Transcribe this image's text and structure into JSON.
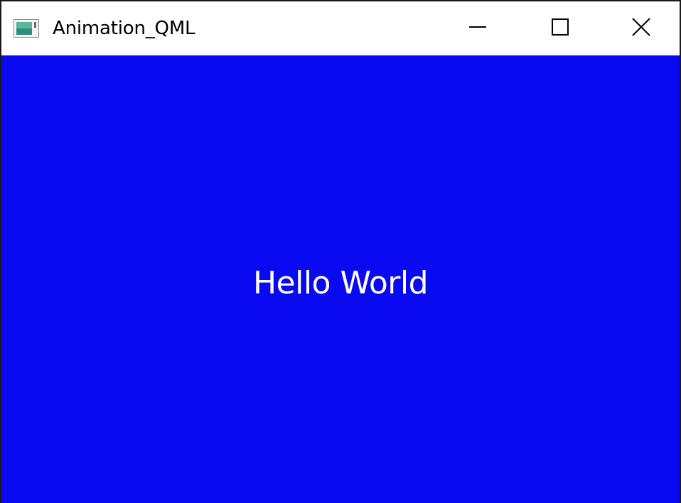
{
  "window": {
    "title": "Animation_QML",
    "app_icon": "qt-app-icon",
    "controls": {
      "minimize_icon": "minimize-icon",
      "maximize_icon": "maximize-icon",
      "close_icon": "close-icon"
    }
  },
  "content": {
    "background_color": "#0a0af2",
    "text": "Hello World",
    "text_color": "#ffffff"
  }
}
